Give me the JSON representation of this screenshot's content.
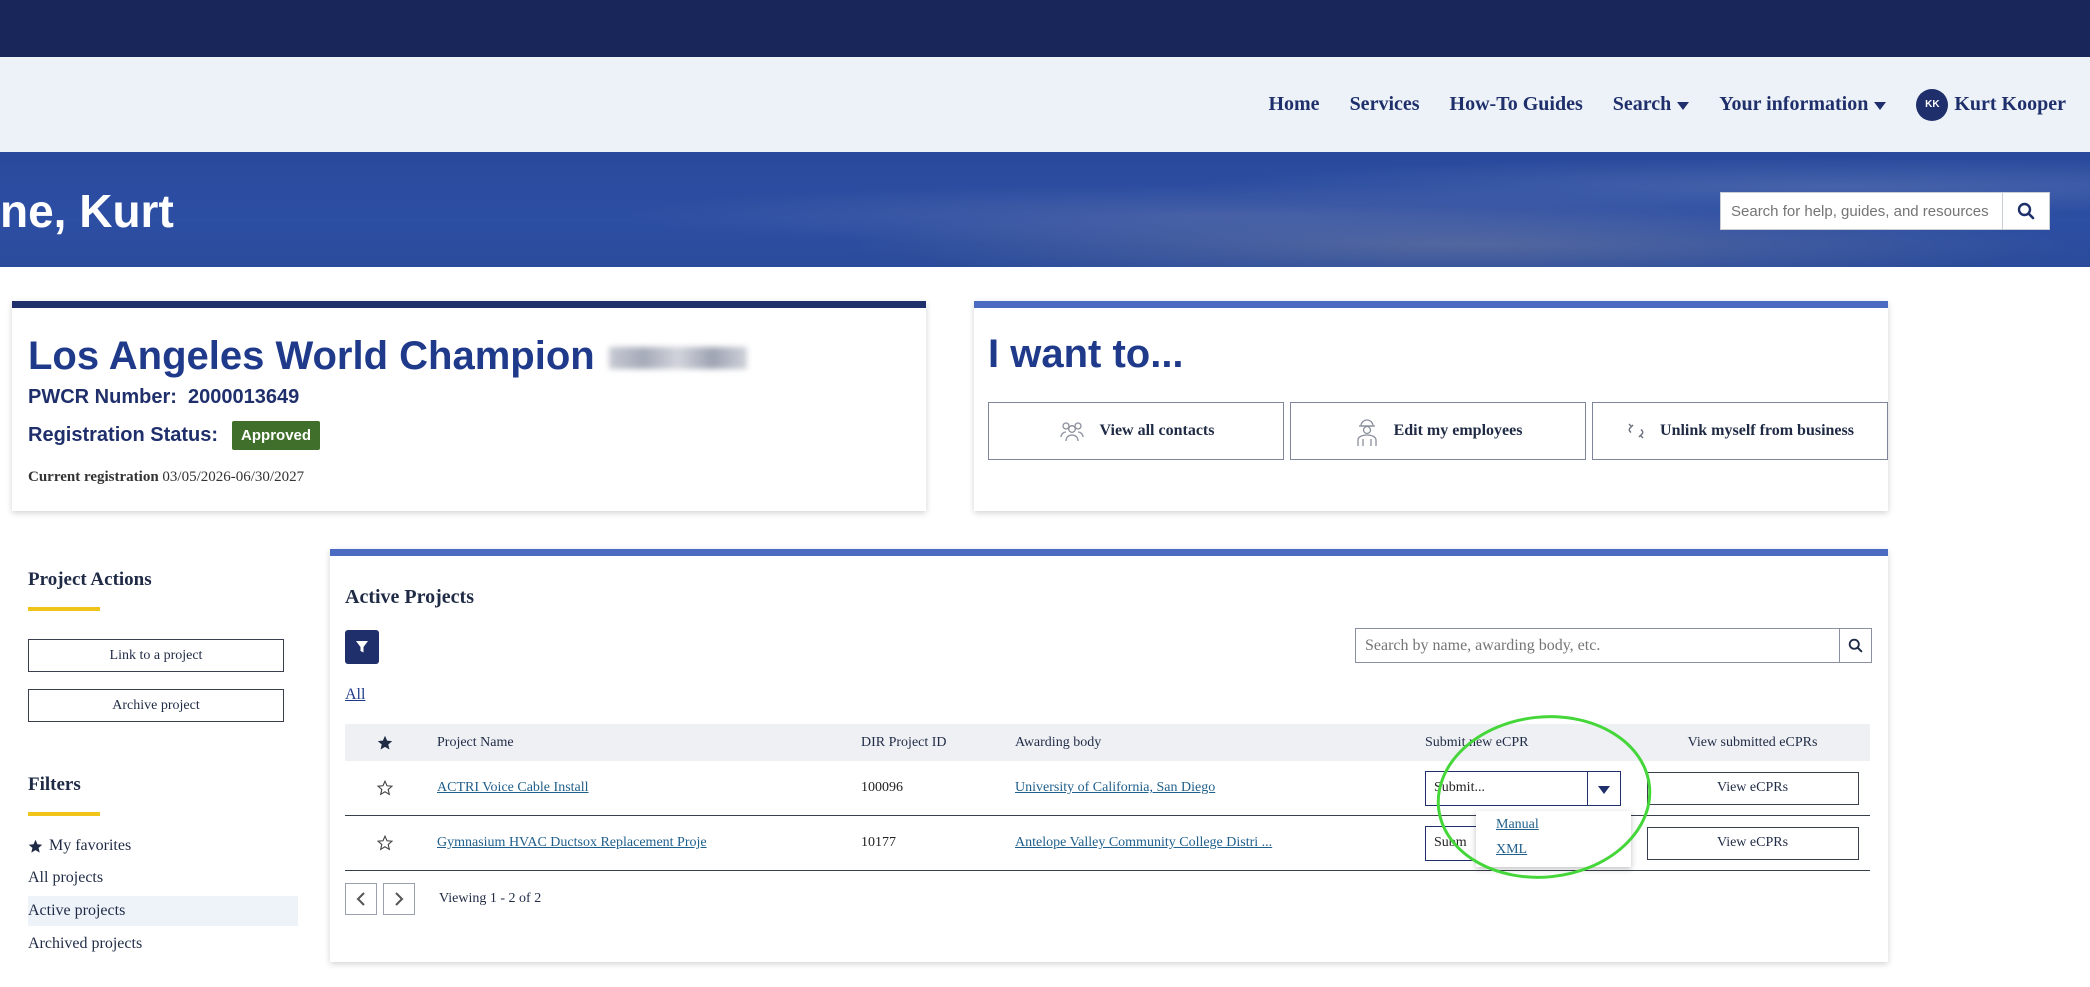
{
  "nav": {
    "items": [
      "Home",
      "Services",
      "How-To Guides",
      "Search",
      "Your information"
    ],
    "user_initials": "KK",
    "user_name": "Kurt Kooper"
  },
  "banner": {
    "greeting": "ne, Kurt",
    "help_search_placeholder": "Search for help, guides, and resources"
  },
  "business": {
    "name": "Los Angeles World Champion",
    "pwcr_label": "PWCR Number:",
    "pwcr_number": "2000013649",
    "status_label": "Registration Status:",
    "status": "Approved",
    "current_registration_label": "Current registration",
    "current_registration_dates": "03/05/2026-06/30/2027"
  },
  "i_want_to": {
    "title": "I want to...",
    "buttons": [
      "View all contacts",
      "Edit my employees",
      "Unlink myself from business"
    ]
  },
  "sidebar": {
    "project_actions_title": "Project Actions",
    "actions": [
      "Link to a project",
      "Archive project"
    ],
    "filters_title": "Filters",
    "filters": [
      "My favorites",
      "All projects",
      "Active projects",
      "Archived projects"
    ]
  },
  "projects": {
    "title": "Active Projects",
    "all_link": "All",
    "search_placeholder": "Search by name, awarding body, etc.",
    "columns": [
      "Project Name",
      "DIR Project ID",
      "Awarding body",
      "Submit new eCPR",
      "View submitted eCPRs"
    ],
    "rows": [
      {
        "name": "ACTRI Voice Cable Install",
        "id": "100096",
        "body": "University of California, San Diego",
        "submit": "Submit...",
        "view": "View eCPRs"
      },
      {
        "name": "Gymnasium HVAC Ductsox Replacement Proje",
        "id": "10177",
        "body": "Antelope Valley Community College Distri ...",
        "submit": "Subm",
        "view": "View eCPRs"
      }
    ],
    "dropdown_options": [
      "Manual",
      "XML"
    ],
    "pager_text": "Viewing 1 - 2 of 2"
  },
  "colors": {
    "navy": "#1f2f6b",
    "approved": "#3f6f2a",
    "highlight": "#45d63a",
    "accent_yellow": "#f0c419"
  }
}
